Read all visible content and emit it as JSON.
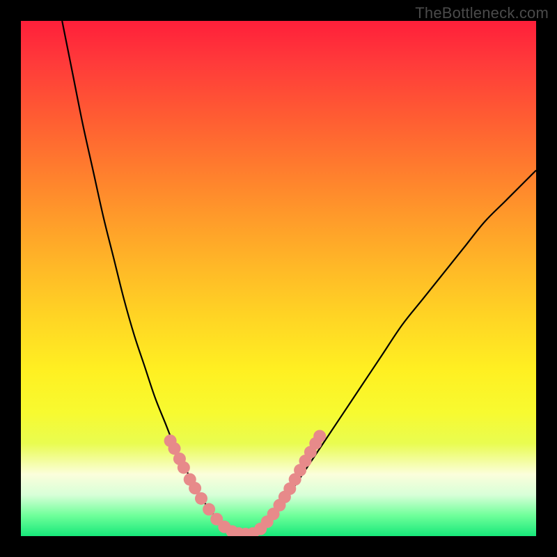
{
  "watermark": "TheBottleneck.com",
  "chart_data": {
    "type": "line",
    "title": "",
    "xlabel": "",
    "ylabel": "",
    "xlim": [
      0,
      100
    ],
    "ylim": [
      0,
      100
    ],
    "series": [
      {
        "name": "curve-left",
        "x": [
          8,
          10,
          12,
          14,
          16,
          18,
          20,
          22,
          24,
          26,
          28,
          30,
          32,
          34,
          36,
          38,
          40,
          42
        ],
        "values": [
          100,
          90,
          80,
          71,
          62,
          54,
          46,
          39,
          33,
          27,
          22,
          17,
          13,
          9,
          6,
          3.5,
          1.5,
          0.3
        ]
      },
      {
        "name": "curve-right",
        "x": [
          44,
          46,
          48,
          50,
          54,
          58,
          62,
          66,
          70,
          74,
          78,
          82,
          86,
          90,
          94,
          98,
          100
        ],
        "values": [
          0.3,
          1.2,
          3,
          5,
          11,
          17,
          23,
          29,
          35,
          41,
          46,
          51,
          56,
          61,
          65,
          69,
          71
        ]
      }
    ],
    "bottom_flat_range_x": [
      40,
      46
    ],
    "markers": {
      "name": "salmon-dots",
      "color": "#e78a8a",
      "radius_px": 9,
      "points": [
        {
          "x": 29.0,
          "y": 18.5
        },
        {
          "x": 29.8,
          "y": 17.0
        },
        {
          "x": 30.8,
          "y": 15.0
        },
        {
          "x": 31.6,
          "y": 13.3
        },
        {
          "x": 32.8,
          "y": 11.0
        },
        {
          "x": 33.8,
          "y": 9.3
        },
        {
          "x": 35.0,
          "y": 7.3
        },
        {
          "x": 36.5,
          "y": 5.2
        },
        {
          "x": 38.0,
          "y": 3.3
        },
        {
          "x": 39.5,
          "y": 1.8
        },
        {
          "x": 41.0,
          "y": 0.9
        },
        {
          "x": 42.3,
          "y": 0.5
        },
        {
          "x": 43.6,
          "y": 0.4
        },
        {
          "x": 45.0,
          "y": 0.5
        },
        {
          "x": 46.5,
          "y": 1.4
        },
        {
          "x": 47.8,
          "y": 2.8
        },
        {
          "x": 49.0,
          "y": 4.3
        },
        {
          "x": 50.2,
          "y": 6.0
        },
        {
          "x": 51.2,
          "y": 7.6
        },
        {
          "x": 52.2,
          "y": 9.2
        },
        {
          "x": 53.2,
          "y": 11.0
        },
        {
          "x": 54.2,
          "y": 12.8
        },
        {
          "x": 55.2,
          "y": 14.6
        },
        {
          "x": 56.2,
          "y": 16.3
        },
        {
          "x": 57.2,
          "y": 18.0
        },
        {
          "x": 58.0,
          "y": 19.4
        }
      ]
    }
  }
}
